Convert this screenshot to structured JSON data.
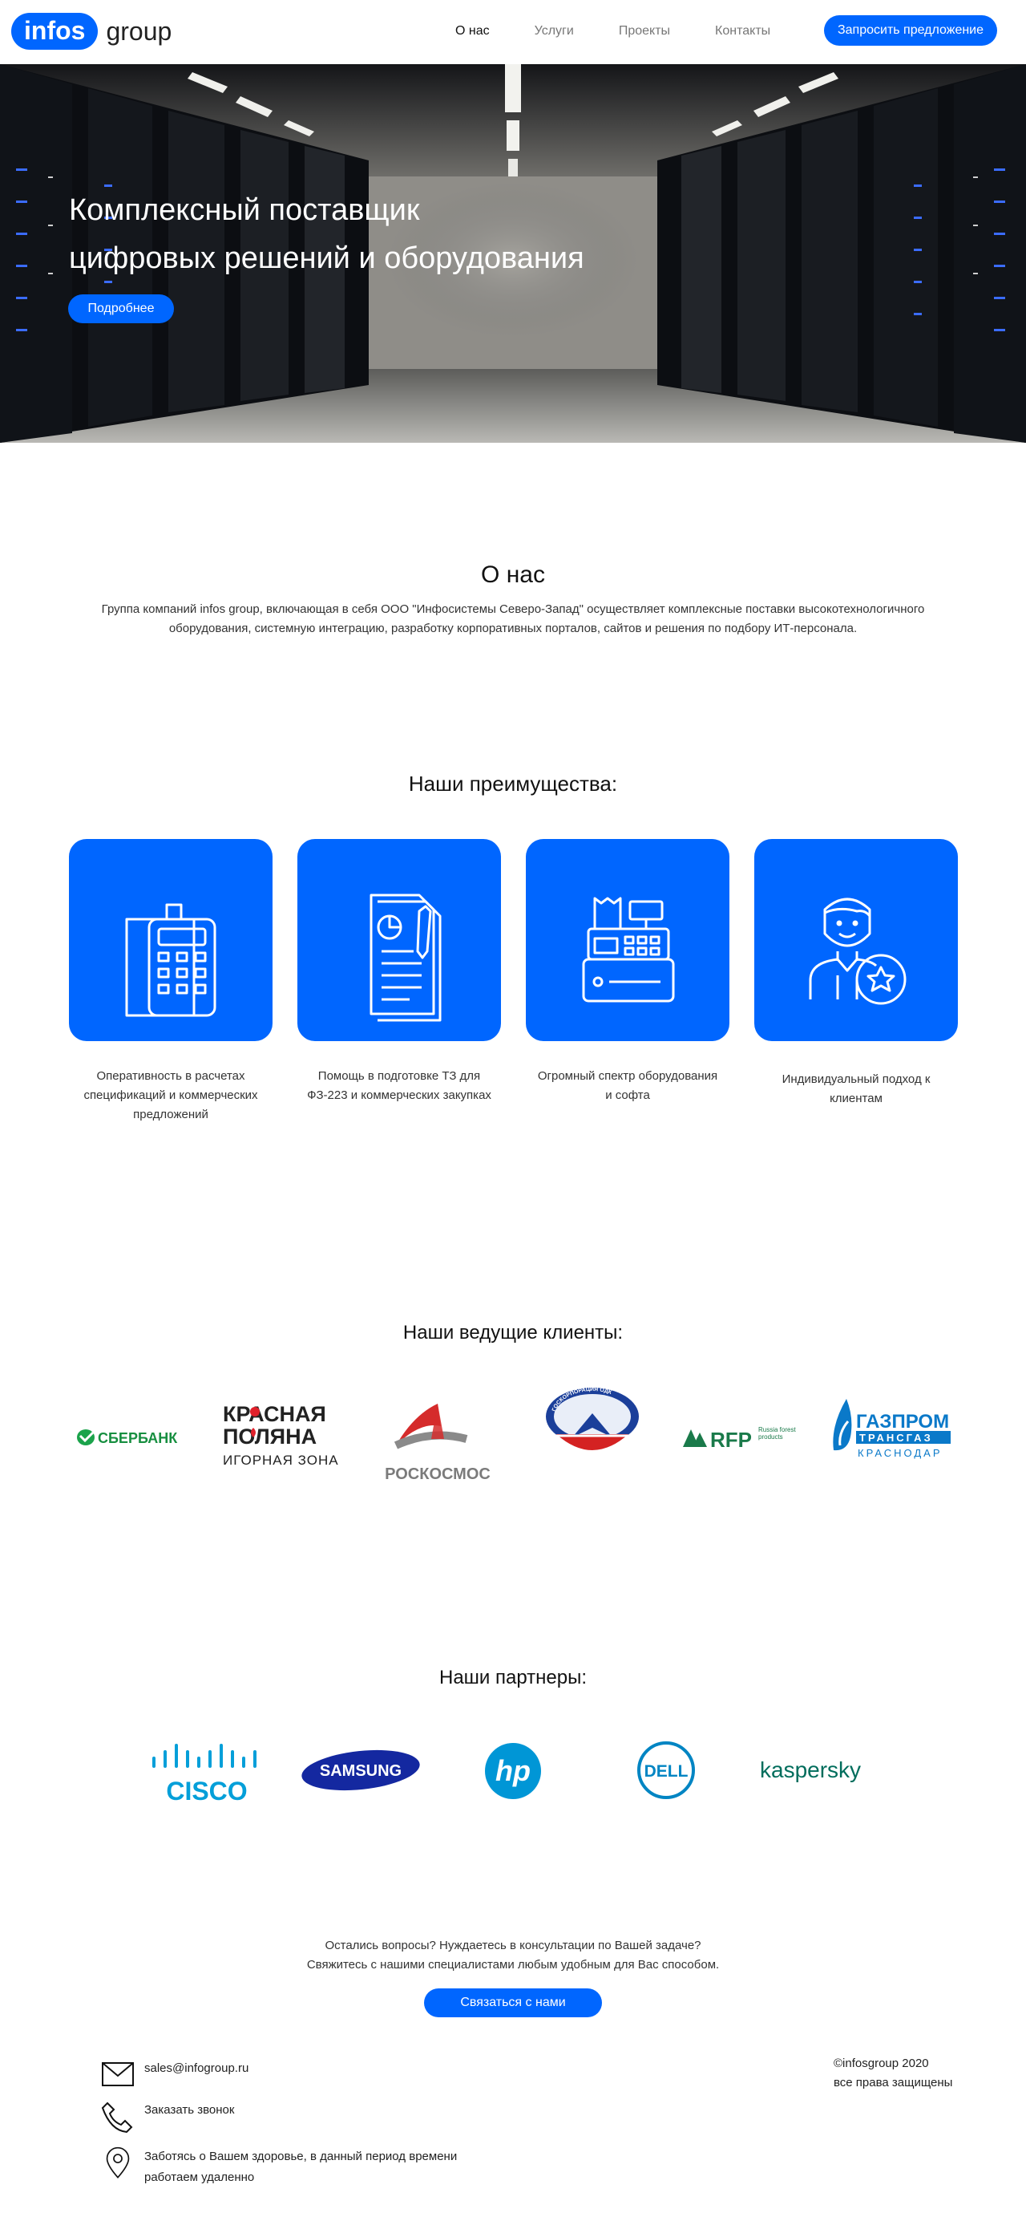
{
  "header": {
    "logo_highlight": "infos",
    "logo_rest": "group",
    "nav": [
      "О нас",
      "Услуги",
      "Проекты",
      "Контакты"
    ],
    "cta": "Запросить предложение"
  },
  "hero": {
    "title_line1": "Комплексный поставщик",
    "title_line2": "цифровых решений и оборудования",
    "button": "Подробнее"
  },
  "about": {
    "title": "О нас",
    "text_line1": "Группа компаний infos group, включающая в себя ООО \"Инфосистемы Северо-Запад\" осуществляет комплексные поставки высокотехнологичного",
    "text_line2": "оборудования, системную интеграцию, разработку корпоративных порталов, сайтов и решения по подбору ИТ-персонала."
  },
  "advantages": {
    "title": "Наши преимущества:",
    "items": [
      {
        "icon": "phone-calculator-icon",
        "l1": "Оперативность в расчетах",
        "l2": "спецификаций и коммерческих",
        "l3": "предложений"
      },
      {
        "icon": "document-chart-icon",
        "l1": "Помощь в подготовке ТЗ для",
        "l2": "ФЗ-223 и коммерческих закупках",
        "l3": ""
      },
      {
        "icon": "cash-register-icon",
        "l1": "Огромный спектр оборудования",
        "l2": "и софта",
        "l3": ""
      },
      {
        "icon": "person-star-icon",
        "l1": "Индивидуальный подход к",
        "l2": "клиентам",
        "l3": ""
      }
    ],
    "color": "#0066ff"
  },
  "clients": {
    "title": "Наши ведущие клиенты:",
    "sberbank": "СБЕРБАНК",
    "krasnaya_1": "КРАСНАЯ",
    "krasnaya_2": "ПОЛЯНА",
    "krasnaya_3": "ИГОРНАЯ ЗОНА",
    "roscosmos": "РОСКОСМОС",
    "gkodk": "ГОСКОРПОРАЦИЯ ОДК",
    "rfp": "RFP",
    "rfp_sub": "Russia forest products",
    "gazprom_1": "ГАЗПРОМ",
    "gazprom_2": "ТРАНСГАЗ",
    "gazprom_3": "КРАСНОДАР"
  },
  "partners": {
    "title": "Наши партнеры:",
    "cisco": "CISCO",
    "samsung": "SAMSUNG",
    "hp": "hp",
    "dell": "DELL",
    "kaspersky": "kaspersky"
  },
  "contact": {
    "line1": "Остались вопросы? Нуждаетесь в консультации по Вашей задаче?",
    "line2": "Свяжитесь с нашими специалистами любым удобным для Вас способом.",
    "button": "Связаться с нами"
  },
  "footer": {
    "email": "sales@infogroup.ru",
    "call": "Заказать звонок",
    "remote_line1": "Заботясь о Вашем здоровье, в данный период времени",
    "remote_line2": "работаем удаленно",
    "copyright_line1": "©infosgroup 2020",
    "copyright_line2": "все права защищены"
  }
}
